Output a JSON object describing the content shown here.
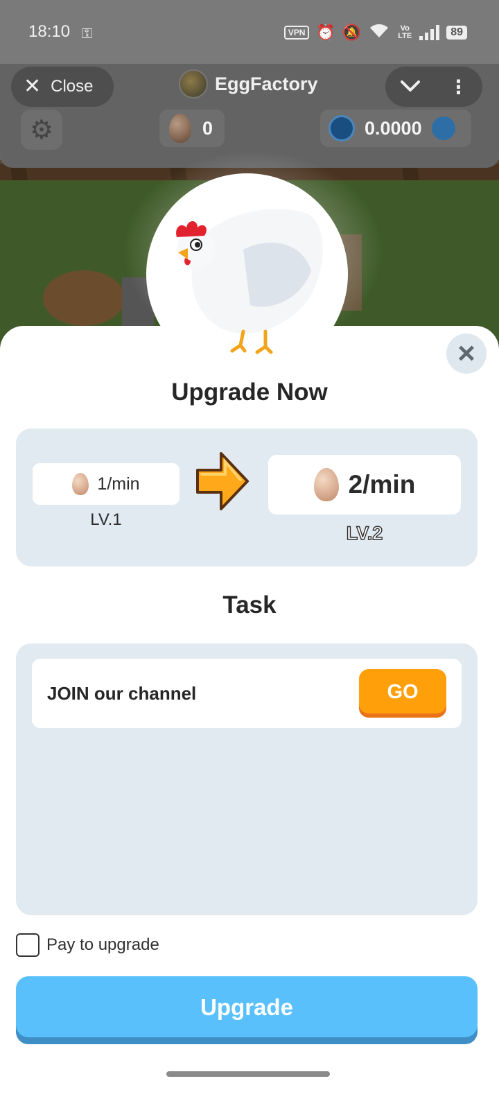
{
  "status_bar": {
    "time": "18:10",
    "vpn": "VPN",
    "volte": "Vo LTE",
    "battery": "89"
  },
  "header": {
    "close_label": "Close",
    "app_name": "EggFactory",
    "egg_balance": "0",
    "ton_balance": "0.0000"
  },
  "upgrade": {
    "title": "Upgrade Now",
    "from_rate": "1/min",
    "from_level": "LV.1",
    "to_rate": "2/min",
    "to_level": "LV.2"
  },
  "task": {
    "title": "Task",
    "items": [
      {
        "label": "JOIN our channel",
        "action": "GO"
      }
    ]
  },
  "pay": {
    "label": "Pay to upgrade",
    "checked": false
  },
  "upgrade_button": "Upgrade",
  "colors": {
    "accent_blue": "#5ac0fb",
    "go_orange": "#ff9f0a",
    "card_bg": "#e1eaf0"
  },
  "icons": [
    "close-icon",
    "chevron-down-icon",
    "more-vert-icon",
    "gear-icon",
    "egg-icon",
    "ton-icon",
    "arrow-right-icon",
    "key-icon",
    "alarm-icon",
    "mute-icon",
    "wifi-icon",
    "signal-icon",
    "battery-icon"
  ]
}
